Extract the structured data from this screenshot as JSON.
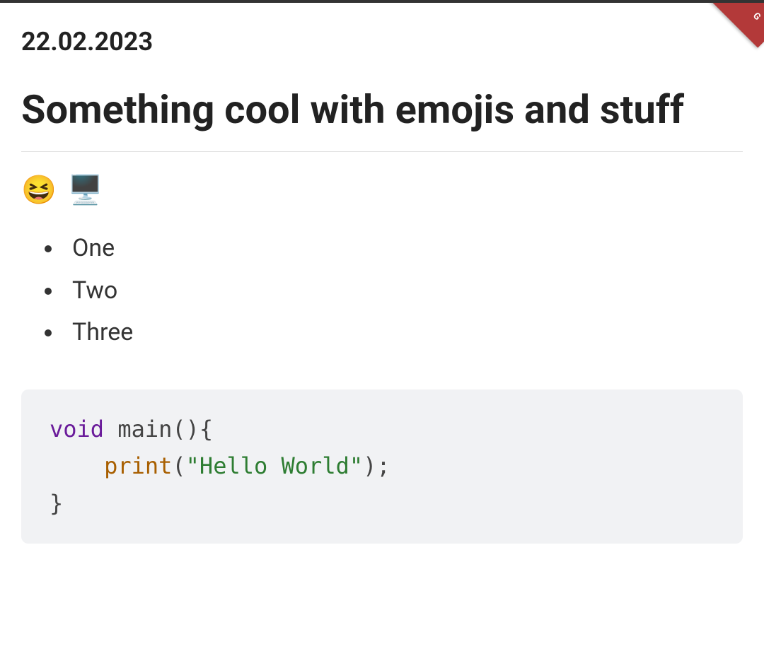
{
  "ribbon": {
    "label": "G"
  },
  "header": {
    "date": "22.02.2023",
    "title": "Something cool with emojis and stuff"
  },
  "emojis": {
    "first": "😆",
    "second": "🖥️"
  },
  "list": {
    "items": [
      "One",
      "Two",
      "Three"
    ]
  },
  "code": {
    "line1_keyword": "void",
    "line1_rest": " main(){",
    "line2_indent": "    ",
    "line2_func": "print",
    "line2_paren_open": "(",
    "line2_string": "\"Hello World\"",
    "line2_paren_close_semi": ");",
    "line3": "}"
  }
}
